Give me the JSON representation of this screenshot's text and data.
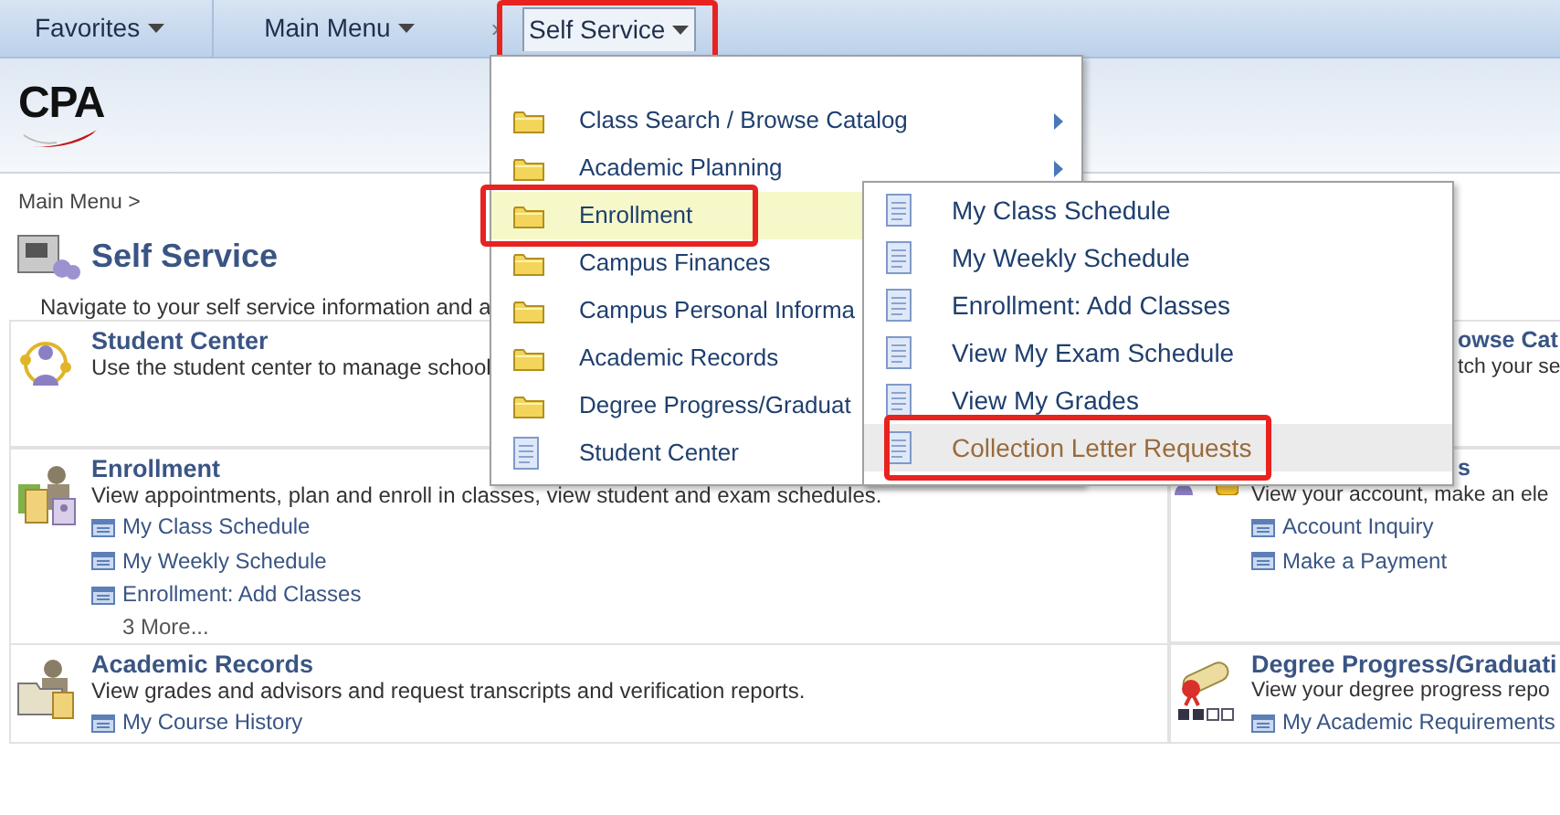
{
  "nav": {
    "items": [
      {
        "label": "Favorites",
        "dropdown": true,
        "selected": false,
        "annotated": false
      },
      {
        "label": "Main Menu",
        "dropdown": true,
        "selected": false,
        "annotated": false
      },
      {
        "label": "Self Service",
        "dropdown": true,
        "selected": true,
        "annotated": true
      }
    ],
    "separator": "›"
  },
  "logo": {
    "text": "CPA"
  },
  "breadcrumb": "Main Menu >",
  "page": {
    "title": "Self Service",
    "description": "Navigate to your self service information and a"
  },
  "tiles_left": [
    {
      "kind": "people",
      "title": "Student Center",
      "description": "Use the student center to manage school"
    },
    {
      "kind": "schedule",
      "title": "Enrollment",
      "description": "View appointments, plan and enroll in classes, view student and exam schedules.",
      "links": [
        "My Class Schedule",
        "My Weekly Schedule",
        "Enrollment: Add Classes"
      ],
      "more": "3 More..."
    },
    {
      "kind": "records",
      "title": "Academic Records",
      "description": "View grades and advisors and request transcripts and verification reports.",
      "links": [
        "My Course History"
      ]
    }
  ],
  "tiles_right": [
    {
      "kind": "hidden",
      "title": "owse Cat",
      "title_covered": true,
      "description": "tch your se",
      "description_covered": true
    },
    {
      "kind": "finance",
      "title": "s",
      "title_covered": true,
      "description": "View your account, make an ele",
      "links": [
        "Account Inquiry",
        "Make a Payment"
      ]
    },
    {
      "kind": "degree",
      "title": "Degree Progress/Graduati",
      "description": "View your degree progress repo",
      "links": [
        "My Academic Requirements"
      ]
    }
  ],
  "menu": {
    "items": [
      {
        "kind": "folder",
        "label": "Class Search / Browse Catalog",
        "submenu": true,
        "selected": false,
        "annotated": false
      },
      {
        "kind": "folder",
        "label": "Academic Planning",
        "submenu": true,
        "selected": false,
        "annotated": false
      },
      {
        "kind": "folder",
        "label": "Enrollment",
        "selected": true,
        "annotated": true
      },
      {
        "kind": "folder",
        "label": "Campus Finances",
        "selected": false,
        "annotated": false
      },
      {
        "kind": "folder",
        "label": "Campus Personal Informa",
        "selected": false,
        "annotated": false
      },
      {
        "kind": "folder",
        "label": "Academic Records",
        "selected": false,
        "annotated": false
      },
      {
        "kind": "folder",
        "label": "Degree Progress/Graduat",
        "selected": false,
        "annotated": false
      },
      {
        "kind": "page",
        "label": "Student Center",
        "selected": false,
        "annotated": false
      }
    ]
  },
  "submenu": {
    "items": [
      {
        "kind": "page",
        "label": "My Class Schedule",
        "selected": false,
        "visited": false,
        "annotated": false
      },
      {
        "kind": "page",
        "label": "My Weekly Schedule",
        "selected": false,
        "visited": false,
        "annotated": false
      },
      {
        "kind": "page",
        "label": "Enrollment: Add Classes",
        "selected": false,
        "visited": false,
        "annotated": false
      },
      {
        "kind": "page",
        "label": "View My Exam Schedule",
        "selected": false,
        "visited": false,
        "annotated": false
      },
      {
        "kind": "page",
        "label": "View My Grades",
        "selected": false,
        "visited": false,
        "annotated": false
      },
      {
        "kind": "page",
        "label": "Collection Letter Requests",
        "selected": true,
        "visited": true,
        "annotated": true
      }
    ]
  }
}
